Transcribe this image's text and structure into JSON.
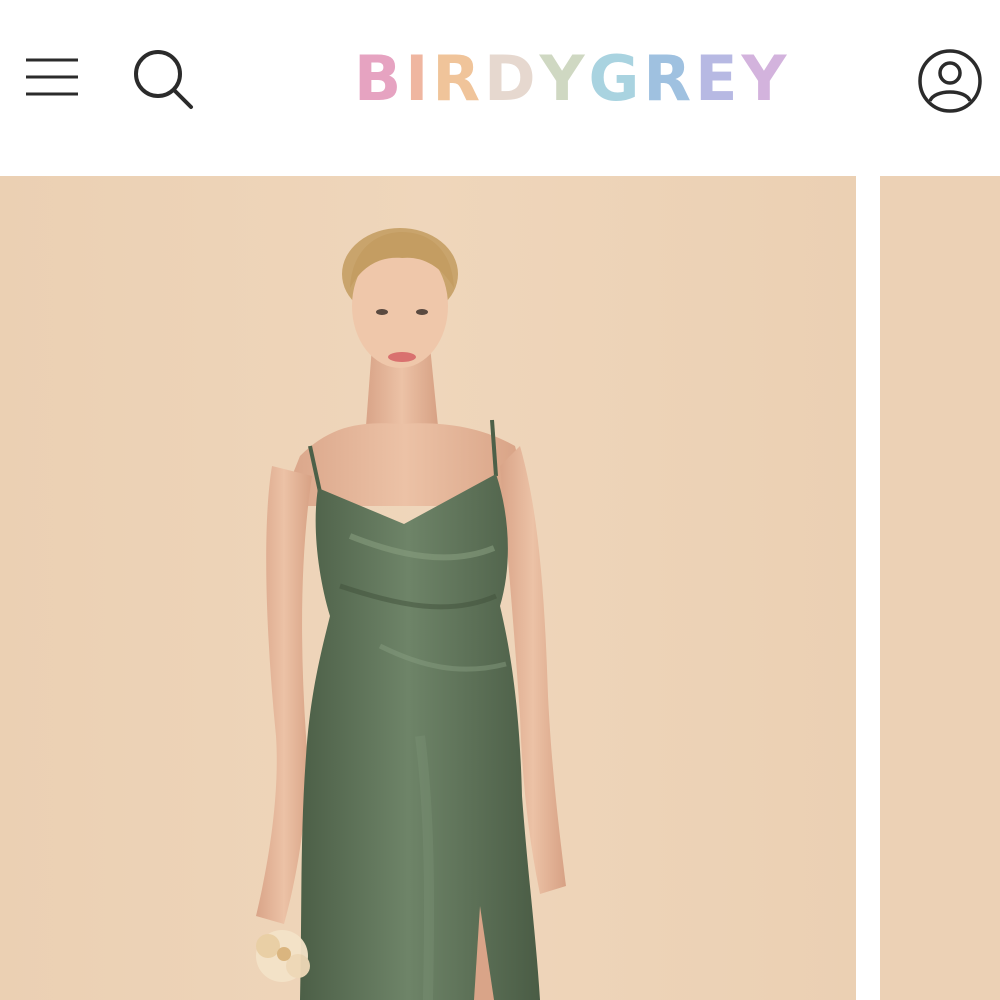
{
  "header": {
    "brand_letters": [
      {
        "ch": "B",
        "color": "#e6a3c1"
      },
      {
        "ch": "I",
        "color": "#efb6a0"
      },
      {
        "ch": "R",
        "color": "#f0c49a"
      },
      {
        "ch": "D",
        "color": "#e6d8cf"
      },
      {
        "ch": "Y",
        "color": "#cfd8c2"
      },
      {
        "ch": "G",
        "color": "#a9d3e0"
      },
      {
        "ch": "R",
        "color": "#9fc1e0"
      },
      {
        "ch": "E",
        "color": "#b7b9e3"
      },
      {
        "ch": "Y",
        "color": "#d3b3dd"
      }
    ],
    "icons": {
      "menu": "hamburger-menu-icon",
      "search": "search-icon",
      "account": "account-icon"
    },
    "icon_color": "#2b2b2b"
  },
  "gallery": {
    "background_color": "#ecd1b5",
    "dress_color": "#5b6f55",
    "slides_visible": 2
  }
}
